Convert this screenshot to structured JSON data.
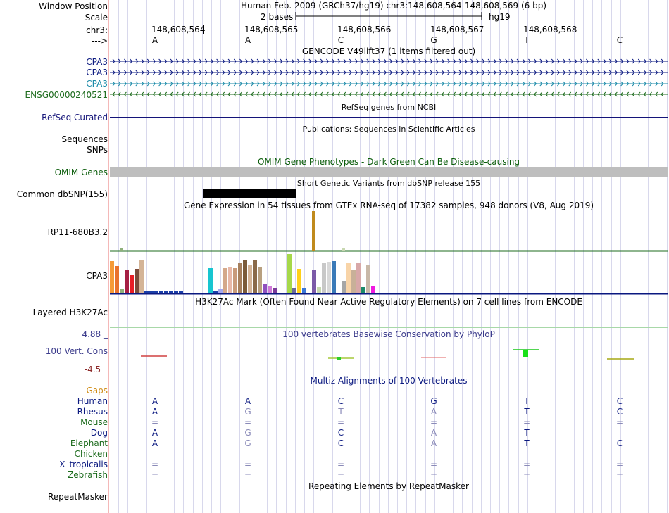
{
  "header": {
    "window_position_label": "Window Position",
    "window_position_text": "Human Feb. 2009 (GRCh37/hg19)   chr3:148,608,564-148,608,569 (6 bp)",
    "scale_label": "Scale",
    "scale_text": "2 bases",
    "scale_assembly": "hg19",
    "chrom_label": "chr3:",
    "strand_label": "--->",
    "positions": [
      "148,608,564",
      "148,608,565",
      "148,608,566",
      "148,608,567",
      "148,608,568"
    ],
    "bases": [
      "A",
      "A",
      "C",
      "G",
      "T",
      "C"
    ]
  },
  "gencode": {
    "title": "GENCODE V49lift37 (1 items filtered out)",
    "items": [
      {
        "label": "CPA3",
        "color": "#0b1980",
        "strand": "+"
      },
      {
        "label": "CPA3",
        "color": "#0b1980",
        "strand": "+"
      },
      {
        "label": "CPA3",
        "color": "#1a8aa8",
        "strand": "+"
      },
      {
        "label": "ENSG00000240521",
        "color": "#1d6b1d",
        "strand": "-"
      }
    ]
  },
  "refseq": {
    "title": "RefSeq genes from NCBI",
    "label": "RefSeq Curated",
    "color": "#141479"
  },
  "publications": {
    "title": "Publications: Sequences in Scientific Articles",
    "labels": [
      "Sequences",
      "SNPs"
    ]
  },
  "omim": {
    "title": "OMIM Gene Phenotypes - Dark Green Can Be Disease-causing",
    "label": "OMIM Genes",
    "color": "#0a5c0a",
    "bar_color": "#bebebe"
  },
  "dbsnp": {
    "title": "Short Genetic Variants from dbSNP release 155",
    "label": "Common dbSNP(155)"
  },
  "gtex": {
    "title": "Gene Expression in 54 tissues from GTEx RNA-seq of 17382 samples, 948 donors (V8, Aug 2019)",
    "genes": [
      {
        "label": "RP11-680B3.2"
      },
      {
        "label": "CPA3"
      }
    ],
    "cpa3_colors": [
      "#f59a37",
      "#e8712d",
      "#8fb07b",
      "#a51f44",
      "#e81e25",
      "#7b4b3a",
      "#d4b497",
      "#1a3ea8",
      "#1a3ea8",
      "#1a3ea8",
      "#1a3ea8",
      "#1a3ea8",
      "#1a3ea8",
      "#1a3ea8",
      "#1a3ea8",
      "#17c5d0",
      "#1a3ea8",
      "#a6a8f0",
      "#d4a88a",
      "#e8b8a8",
      "#c89a7a",
      "#a67f5c",
      "#7b5b3a",
      "#d4b497",
      "#8a6a4a",
      "#b8a080",
      "#9050c0",
      "#d07ad8",
      "#7b3a9a",
      "#a6d84a",
      "#6b6b9a",
      "#ffd01a",
      "#3a78d8",
      "#7c5aa8",
      "#c8d8b0",
      "#c8c8c8",
      "#d8d8d8",
      "#3a7ab8",
      "#a6a6a6",
      "#f8d4a8",
      "#c8b098",
      "#d8a8a8",
      "#1a8a6a",
      "#c8b8a8",
      "#f01ae0"
    ]
  },
  "h3k27ac": {
    "title": "H3K27Ac Mark (Often Found Near Active Regulatory Elements) on 7 cell lines from ENCODE",
    "label": "Layered H3K27Ac"
  },
  "phylop": {
    "title": "100 vertebrates Basewise Conservation by PhyloP",
    "label": "100 Vert. Cons",
    "max_label": "4.88 _",
    "min_label": "-4.5 _",
    "color": "#3c3c8c",
    "max_color": "#3c3c8c",
    "min_color": "#8c2a2a"
  },
  "multiz": {
    "title": "Multiz Alignments of 100 Vertebrates",
    "gaps_label": "Gaps",
    "gaps_color": "#d08c14",
    "species": [
      {
        "name": "Human",
        "color": "#0b1980",
        "bases": [
          "A",
          "A",
          "C",
          "G",
          "T",
          "C"
        ],
        "dim": [
          false,
          false,
          false,
          false,
          false,
          false
        ]
      },
      {
        "name": "Rhesus",
        "color": "#0b1980",
        "bases": [
          "A",
          "G",
          "T",
          "A",
          "T",
          "C"
        ],
        "dim": [
          false,
          true,
          true,
          true,
          false,
          false
        ]
      },
      {
        "name": "Mouse",
        "color": "#1d6b1d",
        "bases": [
          "=",
          "=",
          "=",
          "=",
          "=",
          "="
        ],
        "dim": [
          true,
          true,
          true,
          true,
          true,
          true
        ]
      },
      {
        "name": "Dog",
        "color": "#0b1980",
        "bases": [
          "A",
          "G",
          "C",
          "A",
          "T",
          "-"
        ],
        "dim": [
          false,
          true,
          false,
          true,
          false,
          true
        ]
      },
      {
        "name": "Elephant",
        "color": "#1d6b1d",
        "bases": [
          "A",
          "G",
          "C",
          "A",
          "T",
          "C"
        ],
        "dim": [
          false,
          true,
          false,
          true,
          false,
          false
        ]
      },
      {
        "name": "Chicken",
        "color": "#1d6b1d",
        "bases": [
          "",
          "",
          "",
          "",
          "",
          ""
        ],
        "dim": [
          false,
          false,
          false,
          false,
          false,
          false
        ]
      },
      {
        "name": "X_tropicalis",
        "color": "#0b1980",
        "bases": [
          "=",
          "=",
          "=",
          "=",
          "=",
          "="
        ],
        "dim": [
          true,
          true,
          true,
          true,
          true,
          true
        ]
      },
      {
        "name": "Zebrafish",
        "color": "#1d6b1d",
        "bases": [
          "=",
          "=",
          "=",
          "=",
          "=",
          "="
        ],
        "dim": [
          true,
          true,
          true,
          true,
          true,
          true
        ]
      }
    ]
  },
  "repeatmasker": {
    "title": "Repeating Elements by RepeatMasker",
    "label": "RepeatMasker"
  }
}
